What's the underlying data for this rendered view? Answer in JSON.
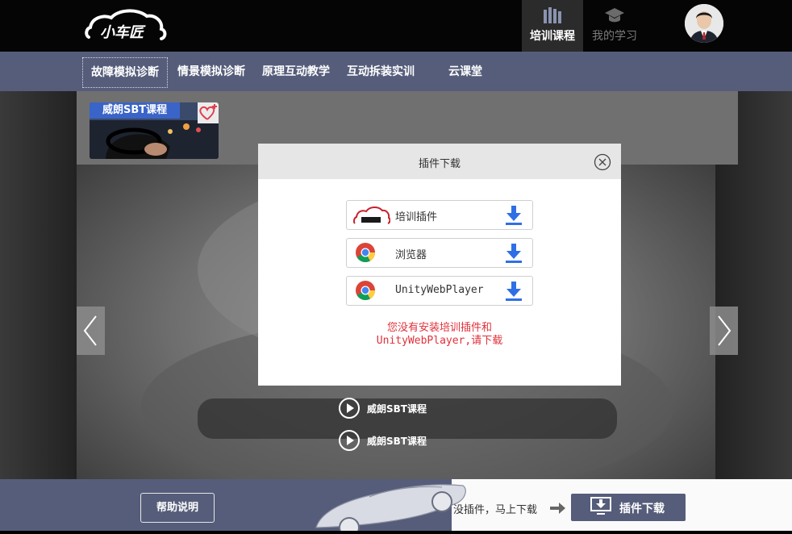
{
  "header": {
    "logo_text": "小车匠",
    "nav": [
      {
        "label": "培训课程",
        "icon": "books-icon",
        "active": true
      },
      {
        "label": "我的学习",
        "icon": "graduation-cap-icon",
        "active": false
      }
    ]
  },
  "subnav": {
    "items": [
      "故障模拟诊断",
      "情景模拟诊断",
      "原理互动教学",
      "互动拆装实训",
      "云课堂"
    ]
  },
  "course": {
    "card_title": "威朗SBT课程",
    "list": [
      "威朗SBT课程",
      "威朗SBT课程"
    ]
  },
  "modal": {
    "title": "插件下载",
    "rows": [
      {
        "label": "培训插件",
        "icon": "xiaochejiang-logo-icon"
      },
      {
        "label": "浏览器",
        "icon": "chrome-icon"
      },
      {
        "label": "UnityWebPlayer",
        "icon": "chrome-icon"
      }
    ],
    "warning_line1": "您没有安装培训插件和",
    "warning_line2": "UnityWebPlayer,请下载"
  },
  "footer": {
    "help_label": "帮助说明",
    "message": "没插件，马上下载",
    "download_label": "插件下载"
  },
  "colors": {
    "nav_bg": "#555d7a",
    "accent_blue": "#3a64c8",
    "download_blue": "#2f6fe6",
    "warning_red": "#e0303a"
  }
}
